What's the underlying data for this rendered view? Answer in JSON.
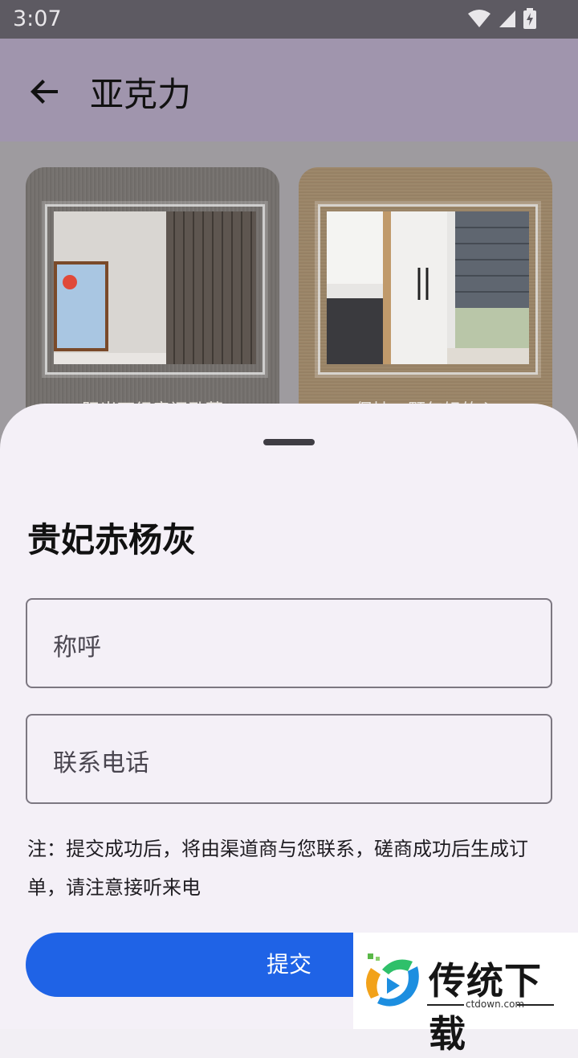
{
  "status_bar": {
    "time": "3:07"
  },
  "app_bar": {
    "title": "亚克力"
  },
  "cards": [
    {
      "caption": "阳光下经意间卧蒂"
    },
    {
      "caption": "保持一颗年轻的心"
    }
  ],
  "sheet": {
    "title": "贵妃赤杨灰",
    "name_placeholder": "称呼",
    "phone_placeholder": "联系电话",
    "note": "注：提交成功后，将由渠道商与您联系，磋商成功后生成订单，请注意接听来电",
    "submit_label": "提交"
  },
  "watermark": {
    "brand": "传统下载",
    "url": "ctdown.com"
  },
  "colors": {
    "primary": "#1f63e6",
    "app_bar": "#a095ad",
    "sheet_bg": "#f4f0f7"
  }
}
